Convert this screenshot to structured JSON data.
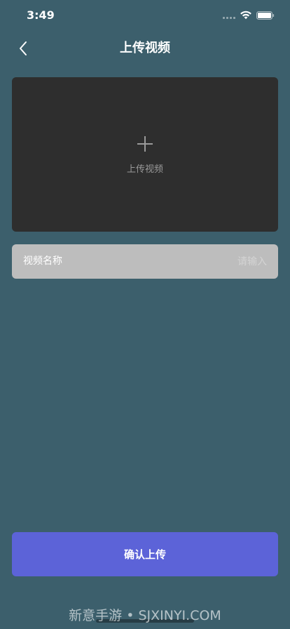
{
  "status_bar": {
    "time": "3:49"
  },
  "nav": {
    "title": "上传视频",
    "back_icon": "chevron-left-icon"
  },
  "upload": {
    "label": "上传视频",
    "icon": "plus-icon"
  },
  "name_field": {
    "label": "视频名称",
    "value": "",
    "placeholder": "请输入"
  },
  "confirm": {
    "label": "确认上传"
  },
  "watermark": {
    "text": "新意手游 • SJXINYI.COM"
  },
  "colors": {
    "background": "#3c5f6c",
    "upload_area": "#2e2e2e",
    "input_bg": "#bdbdbd",
    "accent": "#5c63d8"
  }
}
